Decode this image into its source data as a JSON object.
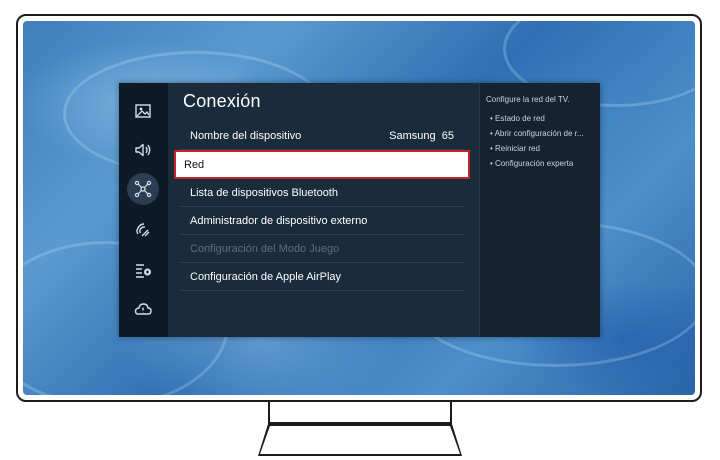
{
  "rail": {
    "icons": [
      "picture-icon",
      "sound-icon",
      "connection-icon",
      "support-icon",
      "general-icon",
      "cloud-icon"
    ],
    "active_index": 2
  },
  "main": {
    "title": "Conexión",
    "items": [
      {
        "label": "Nombre del dispositivo",
        "value": "Samsung  65",
        "state": "normal"
      },
      {
        "label": "Red",
        "value": "",
        "state": "selected"
      },
      {
        "label": "Lista de dispositivos Bluetooth",
        "value": "",
        "state": "normal"
      },
      {
        "label": "Administrador de dispositivo externo",
        "value": "",
        "state": "normal"
      },
      {
        "label": "Configuración del Modo Juego",
        "value": "",
        "state": "disabled"
      },
      {
        "label": "Configuración de Apple AirPlay",
        "value": "",
        "state": "normal"
      }
    ]
  },
  "help": {
    "title": "Configure la red del TV.",
    "items": [
      "Estado de red",
      "Abrir configuración de r...",
      "Reiniciar red",
      "Configuración experta"
    ]
  },
  "colors": {
    "selection_border": "#c4252a",
    "panel_bg": "#1a2b3c",
    "rail_bg": "#0d1a28"
  }
}
